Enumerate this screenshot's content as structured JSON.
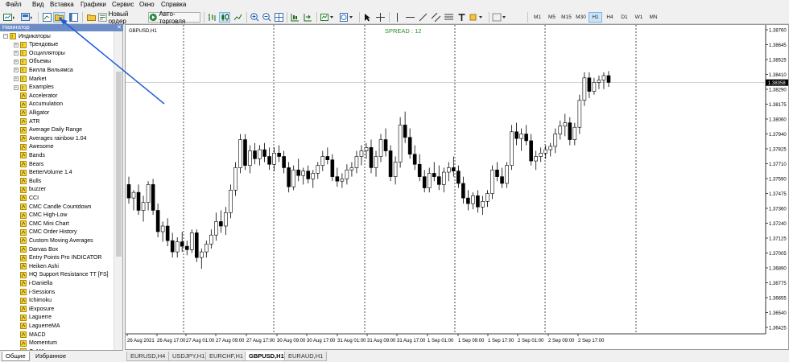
{
  "menu": [
    "Файл",
    "Вид",
    "Вставка",
    "Графики",
    "Сервис",
    "Окно",
    "Справка"
  ],
  "toolbar": {
    "new_order": "Новый ордер",
    "auto_trading": "Авто-торговля",
    "timeframes": [
      "M1",
      "M5",
      "M15",
      "M30",
      "H1",
      "H4",
      "D1",
      "W1",
      "MN"
    ],
    "active_timeframe": "H1"
  },
  "navigator": {
    "title": "Навигатор",
    "root": "Индикаторы",
    "folders": [
      "Трендовые",
      "Осцилляторы",
      "Объемы",
      "Билла Вильямса",
      "Market",
      "Examples"
    ],
    "items": [
      "Accelerator",
      "Accumulation",
      "Alligator",
      "ATR",
      "Average Daily Range",
      "Averages rainbow 1.04",
      "Awesome",
      "Bands",
      "Bears",
      "BetterVolume 1.4",
      "Bulls",
      "buzzer",
      "CCI",
      "CMC Candle Countdown",
      "CMC High-Low",
      "CMC Mini Chart",
      "CMC Order History",
      "Custom Moving Averages",
      "Darvas Box",
      "Entry Points Pro INDICATOR",
      "Heiken Ashi",
      "HQ Support Resistance TT [FS]",
      "i-Daniella",
      "i-Sessions",
      "Ichimoku",
      "iExposure",
      "Laguerre",
      "LaguerreMA",
      "MACD",
      "Momentum",
      "OsMA"
    ],
    "tabs": [
      "Общие",
      "Избранное"
    ]
  },
  "chart": {
    "symbol_label": "GBPUSD,H1",
    "spread_label": "SPREAD : 12",
    "current_price_label": "1.38358",
    "colors": {
      "bull": "#ffffff",
      "bear": "#000000",
      "grid": "#000000",
      "spread": "#2e8b2e"
    }
  },
  "chart_tabs": [
    "EURUSD,H4",
    "USDJPY,H1",
    "EURCHF,H1",
    "GBPUSD,H1",
    "EURAUD,H1"
  ],
  "active_chart_tab": "GBPUSD,H1",
  "chart_data": {
    "type": "candlestick",
    "ylim": [
      1.3612,
      1.3885
    ],
    "y_ticks": [
      "1.38760",
      "1.38645",
      "1.38525",
      "1.38410",
      "1.38290",
      "1.38175",
      "1.38060",
      "1.37940",
      "1.37825",
      "1.37710",
      "1.37590",
      "1.37475",
      "1.37360",
      "1.37240",
      "1.37125",
      "1.37005",
      "1.36890",
      "1.36775",
      "1.36655",
      "1.36540",
      "1.36425"
    ],
    "x_ticks": [
      "26 Aug 2021",
      "26 Aug 17:00",
      "27 Aug 01:00",
      "27 Aug 09:00",
      "27 Aug 17:00",
      "30 Aug 09:00",
      "30 Aug 17:00",
      "31 Aug 01:00",
      "31 Aug 09:00",
      "31 Aug 17:00",
      "1 Sep 01:00",
      "1 Sep 09:00",
      "1 Sep 17:00",
      "2 Sep 01:00",
      "2 Sep 09:00",
      "2 Sep 17:00"
    ],
    "current_price": 1.38358,
    "candles": [
      [
        1.3745,
        1.3752,
        1.3728,
        1.3733
      ],
      [
        1.3733,
        1.374,
        1.3722,
        1.3738
      ],
      [
        1.3738,
        1.3745,
        1.3718,
        1.3722
      ],
      [
        1.3722,
        1.3735,
        1.3712,
        1.3729
      ],
      [
        1.3729,
        1.3748,
        1.3722,
        1.3745
      ],
      [
        1.3745,
        1.375,
        1.3718,
        1.3722
      ],
      [
        1.3722,
        1.3728,
        1.3698,
        1.3703
      ],
      [
        1.3703,
        1.3712,
        1.3694,
        1.3708
      ],
      [
        1.3708,
        1.3715,
        1.369,
        1.3695
      ],
      [
        1.3695,
        1.3702,
        1.368,
        1.3685
      ],
      [
        1.3685,
        1.3698,
        1.368,
        1.3694
      ],
      [
        1.3694,
        1.3703,
        1.3685,
        1.369
      ],
      [
        1.369,
        1.3695,
        1.3682,
        1.3687
      ],
      [
        1.3687,
        1.3705,
        1.3684,
        1.3702
      ],
      [
        1.3702,
        1.3705,
        1.3676,
        1.368
      ],
      [
        1.368,
        1.3688,
        1.367,
        1.3685
      ],
      [
        1.3685,
        1.3695,
        1.368,
        1.3692
      ],
      [
        1.3692,
        1.3705,
        1.3688,
        1.37
      ],
      [
        1.37,
        1.372,
        1.3695,
        1.3712
      ],
      [
        1.3712,
        1.3722,
        1.3702,
        1.3708
      ],
      [
        1.3708,
        1.3725,
        1.37,
        1.372
      ],
      [
        1.372,
        1.3745,
        1.3715,
        1.374
      ],
      [
        1.374,
        1.3765,
        1.3735,
        1.376
      ],
      [
        1.376,
        1.379,
        1.3755,
        1.3785
      ],
      [
        1.3785,
        1.379,
        1.3758,
        1.3762
      ],
      [
        1.3762,
        1.378,
        1.3755,
        1.3775
      ],
      [
        1.3775,
        1.3782,
        1.3763,
        1.3768
      ],
      [
        1.3768,
        1.378,
        1.3762,
        1.3776
      ],
      [
        1.3776,
        1.3782,
        1.3765,
        1.377
      ],
      [
        1.377,
        1.3778,
        1.3758,
        1.3763
      ],
      [
        1.3763,
        1.3778,
        1.3757,
        1.3773
      ],
      [
        1.3773,
        1.378,
        1.3765,
        1.377
      ],
      [
        1.377,
        1.3775,
        1.3755,
        1.376
      ],
      [
        1.376,
        1.3765,
        1.3738,
        1.3743
      ],
      [
        1.3743,
        1.3762,
        1.374,
        1.3758
      ],
      [
        1.3758,
        1.3768,
        1.3748,
        1.3753
      ],
      [
        1.3753,
        1.376,
        1.3745,
        1.3757
      ],
      [
        1.3757,
        1.3762,
        1.3746,
        1.375
      ],
      [
        1.375,
        1.3758,
        1.3742,
        1.3755
      ],
      [
        1.3755,
        1.3765,
        1.375,
        1.3762
      ],
      [
        1.3762,
        1.3775,
        1.3757,
        1.377
      ],
      [
        1.377,
        1.3778,
        1.3763,
        1.3767
      ],
      [
        1.3767,
        1.3772,
        1.3748,
        1.3752
      ],
      [
        1.3752,
        1.376,
        1.3743,
        1.3748
      ],
      [
        1.3748,
        1.3755,
        1.3742,
        1.375
      ],
      [
        1.375,
        1.3763,
        1.3745,
        1.3758
      ],
      [
        1.3758,
        1.3765,
        1.3752,
        1.376
      ],
      [
        1.376,
        1.3775,
        1.3755,
        1.377
      ],
      [
        1.377,
        1.378,
        1.3762,
        1.3775
      ],
      [
        1.3775,
        1.3782,
        1.3768,
        1.3778
      ],
      [
        1.3778,
        1.3785,
        1.3755,
        1.376
      ],
      [
        1.376,
        1.3775,
        1.3752,
        1.377
      ],
      [
        1.377,
        1.379,
        1.3765,
        1.3785
      ],
      [
        1.3785,
        1.3795,
        1.377,
        1.3775
      ],
      [
        1.3775,
        1.378,
        1.3748,
        1.3752
      ],
      [
        1.3752,
        1.377,
        1.3745,
        1.3765
      ],
      [
        1.3765,
        1.3805,
        1.376,
        1.3798
      ],
      [
        1.3798,
        1.381,
        1.3782,
        1.3787
      ],
      [
        1.3787,
        1.3795,
        1.3768,
        1.3772
      ],
      [
        1.3772,
        1.378,
        1.3758,
        1.3763
      ],
      [
        1.3763,
        1.3772,
        1.3748,
        1.3752
      ],
      [
        1.3752,
        1.3758,
        1.3738,
        1.3742
      ],
      [
        1.3742,
        1.376,
        1.3738,
        1.3755
      ],
      [
        1.3755,
        1.3765,
        1.3748,
        1.3752
      ],
      [
        1.3752,
        1.3762,
        1.374,
        1.3745
      ],
      [
        1.3745,
        1.376,
        1.3738,
        1.3756
      ],
      [
        1.3756,
        1.3765,
        1.3748,
        1.376
      ],
      [
        1.376,
        1.377,
        1.3752,
        1.3757
      ],
      [
        1.3757,
        1.3762,
        1.3742,
        1.3746
      ],
      [
        1.3746,
        1.3752,
        1.3728,
        1.3733
      ],
      [
        1.3733,
        1.374,
        1.3722,
        1.3728
      ],
      [
        1.3728,
        1.3738,
        1.3723,
        1.3735
      ],
      [
        1.3735,
        1.374,
        1.372,
        1.3725
      ],
      [
        1.3725,
        1.3735,
        1.3718,
        1.373
      ],
      [
        1.373,
        1.374,
        1.3725,
        1.3737
      ],
      [
        1.3737,
        1.3762,
        1.3732,
        1.3758
      ],
      [
        1.3758,
        1.3765,
        1.3748,
        1.3752
      ],
      [
        1.3752,
        1.376,
        1.3742,
        1.3746
      ],
      [
        1.3746,
        1.3765,
        1.3742,
        1.3762
      ],
      [
        1.3762,
        1.3798,
        1.3758,
        1.3792
      ],
      [
        1.3792,
        1.38,
        1.378,
        1.3786
      ],
      [
        1.3786,
        1.3795,
        1.3775,
        1.379
      ],
      [
        1.379,
        1.3798,
        1.378,
        1.3784
      ],
      [
        1.3784,
        1.379,
        1.3762,
        1.3766
      ],
      [
        1.3766,
        1.3775,
        1.3758,
        1.377
      ],
      [
        1.377,
        1.3778,
        1.3765,
        1.3773
      ],
      [
        1.3773,
        1.378,
        1.3768,
        1.3776
      ],
      [
        1.3776,
        1.3782,
        1.377,
        1.3779
      ],
      [
        1.3779,
        1.3795,
        1.3773,
        1.379
      ],
      [
        1.379,
        1.3802,
        1.3785,
        1.3797
      ],
      [
        1.3797,
        1.3808,
        1.3788,
        1.38
      ],
      [
        1.38,
        1.3805,
        1.378,
        1.3785
      ],
      [
        1.3785,
        1.38,
        1.378,
        1.3796
      ],
      [
        1.3796,
        1.3825,
        1.379,
        1.382
      ],
      [
        1.382,
        1.3845,
        1.3815,
        1.384
      ],
      [
        1.384,
        1.3845,
        1.3822,
        1.3828
      ],
      [
        1.3828,
        1.384,
        1.3825,
        1.3836
      ],
      [
        1.3836,
        1.3842,
        1.383,
        1.3838
      ],
      [
        1.3838,
        1.3845,
        1.383,
        1.3842
      ],
      [
        1.3842,
        1.3846,
        1.3832,
        1.3836
      ]
    ]
  }
}
